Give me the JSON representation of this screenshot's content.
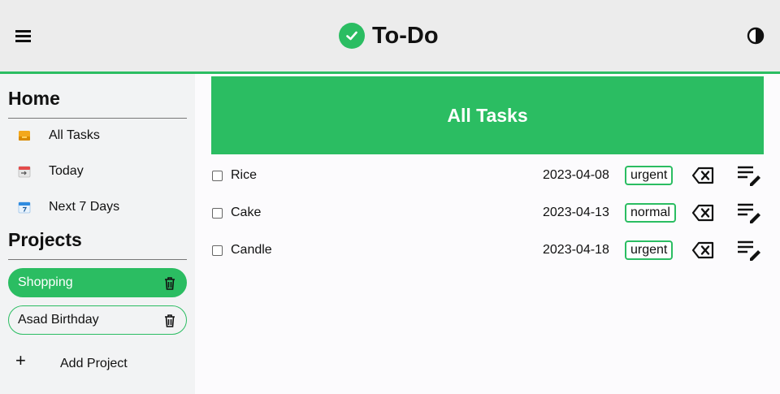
{
  "header": {
    "title": "To-Do",
    "menu_icon": "hamburger-menu-icon",
    "logo_icon": "check-circle-icon",
    "theme_icon": "contrast-icon"
  },
  "sidebar": {
    "home_title": "Home",
    "nav_items": [
      {
        "label": "All Tasks",
        "icon": "inbox-tray-icon"
      },
      {
        "label": "Today",
        "icon": "calendar-today-icon"
      },
      {
        "label": "Next 7 Days",
        "icon": "calendar-week-icon"
      }
    ],
    "projects_title": "Projects",
    "projects": [
      {
        "label": "Shopping",
        "active": true
      },
      {
        "label": "Asad Birthday",
        "active": false
      }
    ],
    "add_project_icon": "+",
    "add_project_label": "Add Project"
  },
  "main": {
    "title": "All Tasks",
    "tasks": [
      {
        "name": "Rice",
        "date": "2023-04-08",
        "priority": "urgent",
        "done": false
      },
      {
        "name": "Cake",
        "date": "2023-04-13",
        "priority": "normal",
        "done": false
      },
      {
        "name": "Candle",
        "date": "2023-04-18",
        "priority": "urgent",
        "done": false
      }
    ]
  },
  "colors": {
    "accent": "#2bbd62",
    "header_bg": "#ececec",
    "sidebar_bg": "#f2f3f4"
  }
}
